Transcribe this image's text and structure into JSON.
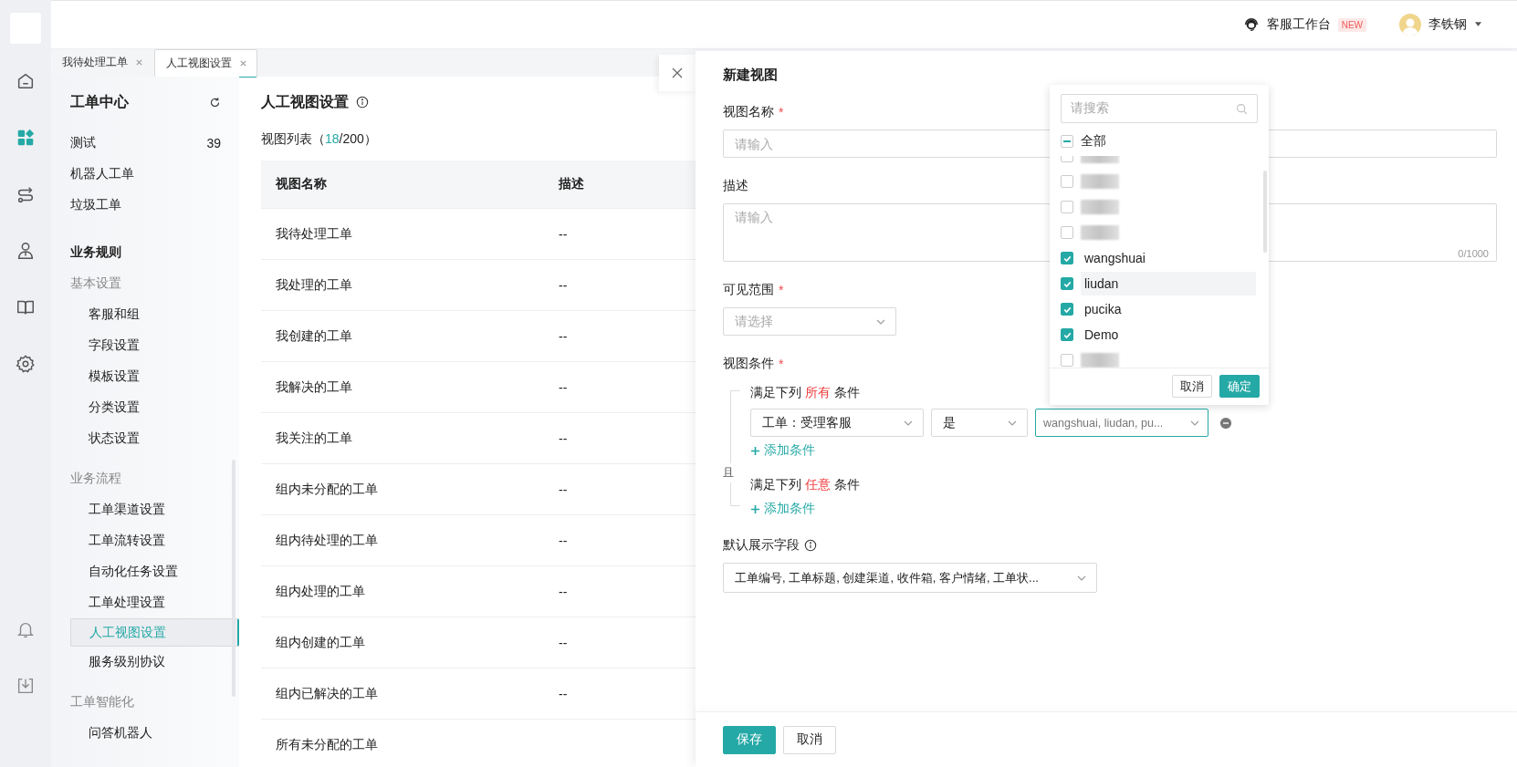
{
  "topbar": {
    "workbench": {
      "label": "客服工作台",
      "badge": "NEW"
    },
    "user": {
      "name": "李铁钢"
    }
  },
  "rail": [
    {
      "selected": false
    },
    {
      "selected": true
    },
    {
      "selected": false
    },
    {
      "selected": false
    },
    {
      "selected": false
    },
    {
      "selected": false
    }
  ],
  "tabs": [
    {
      "label": "我待处理工单",
      "selected": false
    },
    {
      "label": "人工视图设置",
      "selected": true
    }
  ],
  "nav": {
    "title": "工单中心",
    "top_items": [
      {
        "label": "测试",
        "count": "39",
        "selected": false
      },
      {
        "label": "机器人工单",
        "selected": false
      },
      {
        "label": "垃圾工单",
        "selected": false
      }
    ],
    "sections": [
      {
        "heading": "业务规则",
        "groups": [
          {
            "title": "基本设置",
            "items": [
              {
                "label": "客服和组",
                "selected": false
              },
              {
                "label": "字段设置",
                "selected": false
              },
              {
                "label": "模板设置",
                "selected": false
              },
              {
                "label": "分类设置",
                "selected": false
              },
              {
                "label": "状态设置",
                "selected": false
              }
            ]
          },
          {
            "title": "业务流程",
            "items": [
              {
                "label": "工单渠道设置",
                "selected": false
              },
              {
                "label": "工单流转设置",
                "selected": false
              },
              {
                "label": "自动化任务设置",
                "selected": false
              },
              {
                "label": "工单处理设置",
                "selected": false
              },
              {
                "label": "人工视图设置",
                "selected": true
              },
              {
                "label": "服务级别协议",
                "selected": false
              }
            ]
          },
          {
            "title": "工单智能化",
            "items": [
              {
                "label": "问答机器人",
                "selected": false
              }
            ]
          }
        ]
      }
    ]
  },
  "main": {
    "title": "人工视图设置",
    "list_label": {
      "prefix": "视图列表（",
      "count": "18",
      "suffix": "/200）"
    },
    "table": {
      "columns": [
        "视图名称",
        "描述"
      ],
      "rows": [
        [
          "我待处理工单",
          "--"
        ],
        [
          "我处理的工单",
          "--"
        ],
        [
          "我创建的工单",
          "--"
        ],
        [
          "我解决的工单",
          "--"
        ],
        [
          "我关注的工单",
          "--"
        ],
        [
          "组内未分配的工单",
          "--"
        ],
        [
          "组内待处理的工单",
          "--"
        ],
        [
          "组内处理的工单",
          "--"
        ],
        [
          "组内创建的工单",
          "--"
        ],
        [
          "组内已解决的工单",
          "--"
        ],
        [
          "所有未分配的工单"
        ]
      ]
    }
  },
  "drawer": {
    "title": "新建视图",
    "fields": [
      {
        "kind": "text",
        "label": "视图名称",
        "required_mark": "*",
        "placeholder": "请输入"
      },
      {
        "kind": "textarea",
        "label": "描述",
        "placeholder": "请输入",
        "counter": "0/1000"
      },
      {
        "kind": "select",
        "label": "可见范围",
        "required_mark": "*",
        "placeholder": "请选择"
      },
      {
        "kind": "conditions",
        "label": "视图条件",
        "required_mark": "*",
        "connector": "且",
        "groups": [
          {
            "prefix": "满足下列",
            "mode": "所有",
            "suffix": "条件",
            "conditions": [
              {
                "field": "工单：受理客服",
                "operator": "是",
                "value": "wangshuai, liudan, pu...",
                "focused": true
              }
            ],
            "add": "添加条件"
          },
          {
            "prefix": "满足下列",
            "mode": "任意",
            "suffix": "条件",
            "add": "添加条件"
          }
        ]
      },
      {
        "kind": "multiselect",
        "label": "默认展示字段",
        "info": true,
        "value": "工单编号, 工单标题, 创建渠道, 收件箱, 客户情绪, 工单状..."
      }
    ],
    "buttons": [
      {
        "label": "保存",
        "primary": true
      },
      {
        "label": "取消",
        "primary": false
      }
    ]
  },
  "dropdown": {
    "search_placeholder": "请搜索",
    "select_all": {
      "label": "全部",
      "indeterminate": true
    },
    "options": [
      {
        "kind": "redacted",
        "checked": false
      },
      {
        "kind": "redacted",
        "checked": false
      },
      {
        "kind": "redacted",
        "checked": false
      },
      {
        "kind": "redacted",
        "checked": false
      },
      {
        "kind": "text",
        "label": "wangshuai",
        "checked": true,
        "highlighted": false
      },
      {
        "kind": "text",
        "label": "liudan",
        "checked": true,
        "highlighted": true
      },
      {
        "kind": "text",
        "label": "pucika",
        "checked": true,
        "highlighted": false
      },
      {
        "kind": "text",
        "label": "Demo",
        "checked": true,
        "highlighted": false
      },
      {
        "kind": "redacted",
        "checked": false
      }
    ],
    "buttons": [
      {
        "label": "取消",
        "primary": false
      },
      {
        "label": "确定",
        "primary": true
      }
    ]
  }
}
